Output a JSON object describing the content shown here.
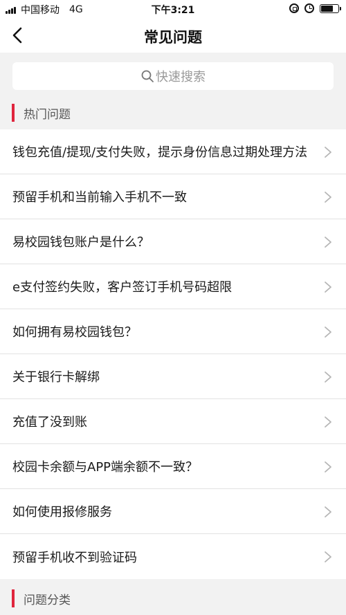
{
  "status_bar": {
    "carrier": "中国移动",
    "network": "4G",
    "time": "下午3:21",
    "battery_level": 0.72,
    "icons": [
      "signal-icon",
      "orientation-lock-icon",
      "alarm-icon",
      "battery-icon"
    ]
  },
  "nav": {
    "title": "常见问题",
    "back_icon": "chevron-left-icon"
  },
  "search": {
    "placeholder": "快速搜索",
    "icon": "search-icon"
  },
  "sections": {
    "hot": {
      "title": "热门问题"
    },
    "category": {
      "title": "问题分类"
    }
  },
  "faq_items": [
    "钱包充值/提现/支付失败，提示身份信息过期处理方法",
    "预留手机和当前输入手机不一致",
    "易校园钱包账户是什么？",
    "e支付签约失败，客户签订手机号码超限",
    "如何拥有易校园钱包？",
    "关于银行卡解绑",
    "充值了没到账",
    "校园卡余额与APP端余额不一致？",
    "如何使用报修服务",
    "预留手机收不到验证码"
  ],
  "colors": {
    "accent": "#e0253d",
    "background": "#f2f2f2",
    "chevron": "#b5b5b5"
  }
}
